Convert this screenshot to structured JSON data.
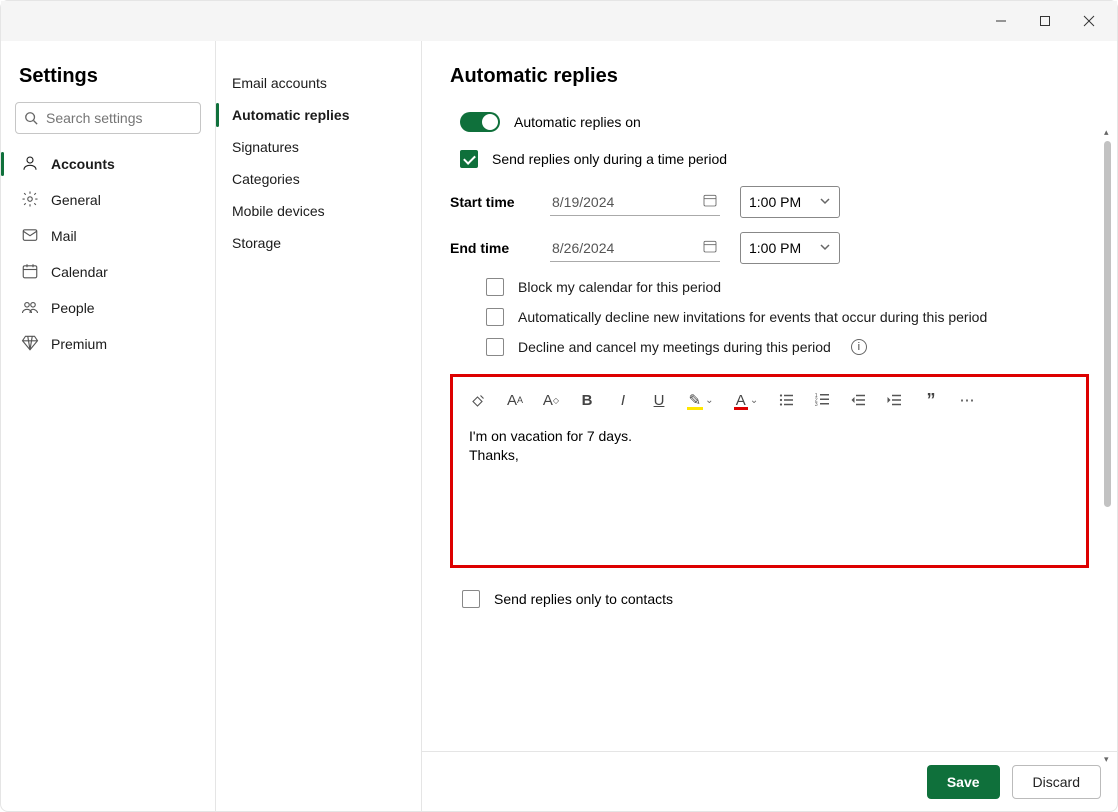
{
  "window": {
    "title": "Settings"
  },
  "sidebar": {
    "title": "Settings",
    "search_placeholder": "Search settings",
    "items": [
      {
        "label": "Accounts",
        "icon": "person"
      },
      {
        "label": "General",
        "icon": "gear"
      },
      {
        "label": "Mail",
        "icon": "envelope"
      },
      {
        "label": "Calendar",
        "icon": "calendar"
      },
      {
        "label": "People",
        "icon": "people"
      },
      {
        "label": "Premium",
        "icon": "diamond"
      }
    ]
  },
  "subnav": {
    "items": [
      {
        "label": "Email accounts"
      },
      {
        "label": "Automatic replies"
      },
      {
        "label": "Signatures"
      },
      {
        "label": "Categories"
      },
      {
        "label": "Mobile devices"
      },
      {
        "label": "Storage"
      }
    ]
  },
  "main": {
    "heading": "Automatic replies",
    "toggle_label": "Automatic replies on",
    "time_period_label": "Send replies only during a time period",
    "start_label": "Start time",
    "start_date": "8/19/2024",
    "start_time": "1:00 PM",
    "end_label": "End time",
    "end_date": "8/26/2024",
    "end_time": "1:00 PM",
    "block_calendar_label": "Block my calendar for this period",
    "decline_new_label": "Automatically decline new invitations for events that occur during this period",
    "decline_cancel_label": "Decline and cancel my meetings during this period",
    "editor_line1": "I'm on vacation for 7 days.",
    "editor_line2": "Thanks,",
    "contacts_only_label": "Send replies only to contacts"
  },
  "footer": {
    "save": "Save",
    "discard": "Discard"
  }
}
